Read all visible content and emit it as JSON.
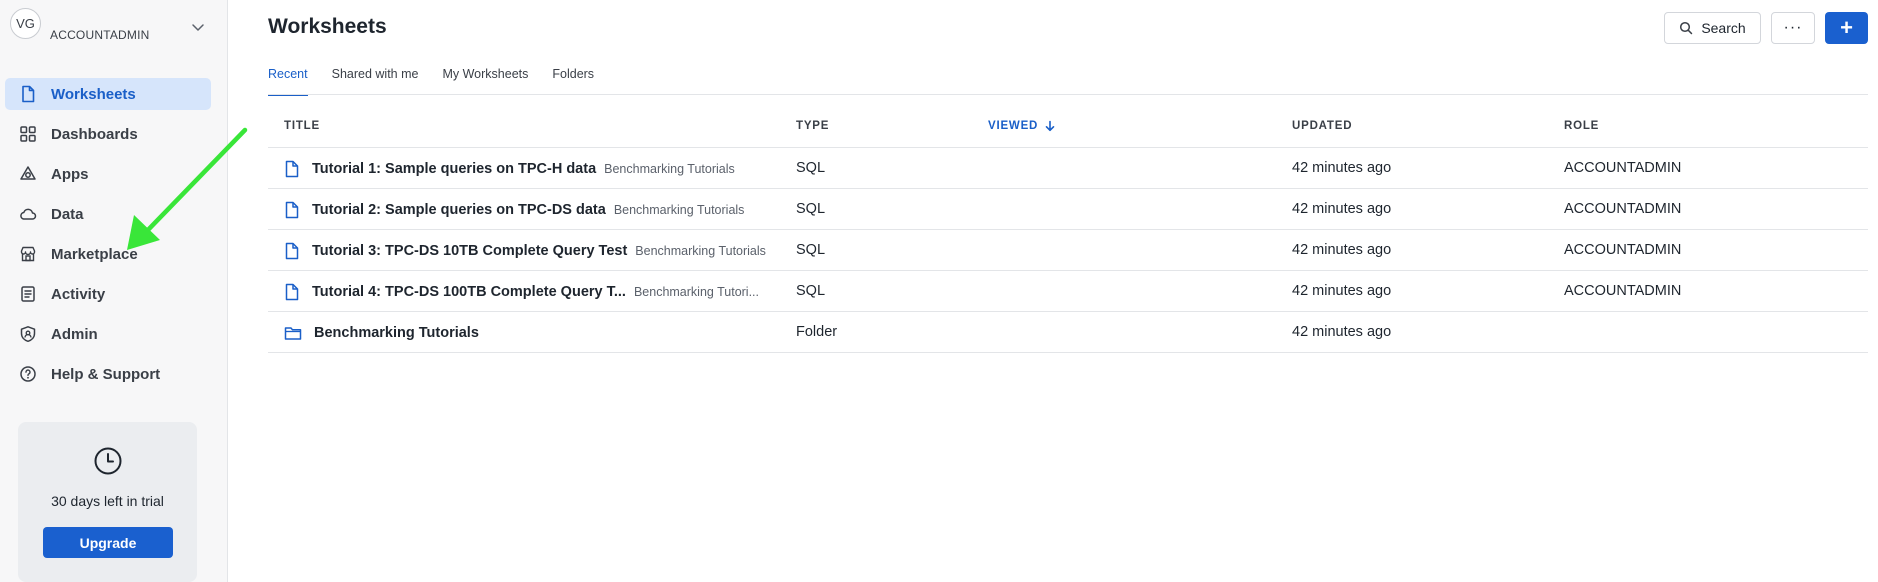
{
  "account": {
    "initials": "VG",
    "role": "ACCOUNTADMIN"
  },
  "sidebar": {
    "items": [
      {
        "label": "Worksheets",
        "icon": "document-icon",
        "active": true
      },
      {
        "label": "Dashboards",
        "icon": "grid-icon",
        "active": false
      },
      {
        "label": "Apps",
        "icon": "apps-icon",
        "active": false
      },
      {
        "label": "Data",
        "icon": "cloud-icon",
        "active": false
      },
      {
        "label": "Marketplace",
        "icon": "storefront-icon",
        "active": false
      },
      {
        "label": "Activity",
        "icon": "activity-icon",
        "active": false
      },
      {
        "label": "Admin",
        "icon": "shield-icon",
        "active": false
      },
      {
        "label": "Help & Support",
        "icon": "help-icon",
        "active": false
      }
    ],
    "trial": {
      "text": "30 days left in trial",
      "button": "Upgrade"
    }
  },
  "header": {
    "title": "Worksheets",
    "search_label": "Search",
    "more_label": "···",
    "add_label": "+"
  },
  "tabs": [
    {
      "label": "Recent",
      "active": true
    },
    {
      "label": "Shared with me",
      "active": false
    },
    {
      "label": "My Worksheets",
      "active": false
    },
    {
      "label": "Folders",
      "active": false
    }
  ],
  "table": {
    "columns": {
      "title": "TITLE",
      "type": "TYPE",
      "viewed": "VIEWED",
      "updated": "UPDATED",
      "role": "ROLE"
    },
    "rows": [
      {
        "title": "Tutorial 1: Sample queries on TPC-H data",
        "folder": "Benchmarking Tutorials",
        "type": "SQL",
        "updated": "42 minutes ago",
        "role": "ACCOUNTADMIN",
        "icon": "worksheet-icon"
      },
      {
        "title": "Tutorial 2: Sample queries on TPC-DS data",
        "folder": "Benchmarking Tutorials",
        "type": "SQL",
        "updated": "42 minutes ago",
        "role": "ACCOUNTADMIN",
        "icon": "worksheet-icon"
      },
      {
        "title": "Tutorial 3: TPC-DS 10TB Complete Query Test",
        "folder": "Benchmarking Tutorials",
        "type": "SQL",
        "updated": "42 minutes ago",
        "role": "ACCOUNTADMIN",
        "icon": "worksheet-icon"
      },
      {
        "title": "Tutorial 4: TPC-DS 100TB Complete Query T...",
        "folder": "Benchmarking Tutori...",
        "type": "SQL",
        "updated": "42 minutes ago",
        "role": "ACCOUNTADMIN",
        "icon": "worksheet-icon"
      },
      {
        "title": "Benchmarking Tutorials",
        "folder": "",
        "type": "Folder",
        "updated": "42 minutes ago",
        "role": "",
        "icon": "folder-icon"
      }
    ]
  },
  "colors": {
    "accent": "#1a60cf",
    "active_nav_bg": "#d6e5fb",
    "annotation_arrow": "#39e639"
  }
}
